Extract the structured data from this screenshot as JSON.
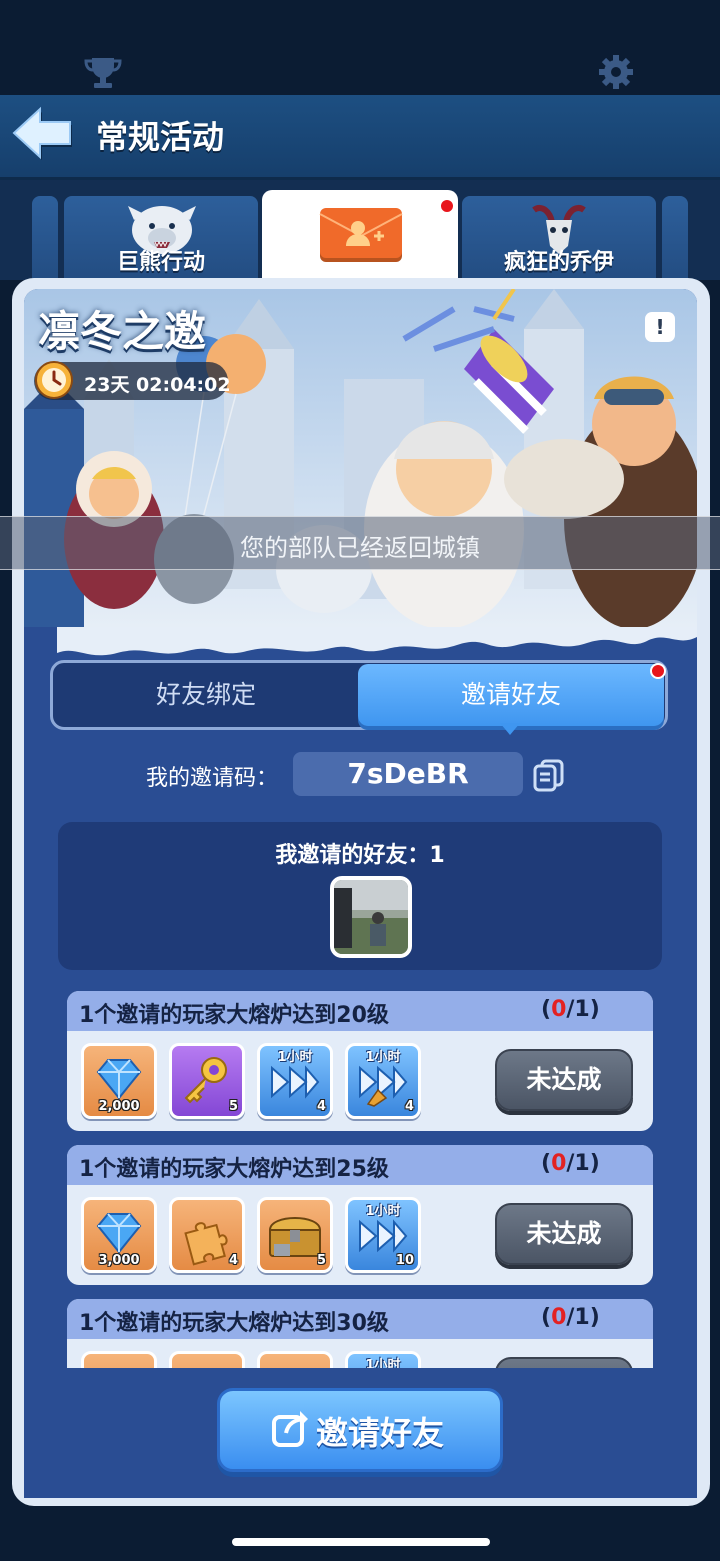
{
  "header": {
    "title": "常规活动",
    "trophy_icon": "trophy-icon",
    "settings_icon": "gear-icon",
    "back_icon": "back-arrow-icon"
  },
  "tabs": [
    {
      "label": "巨熊行动",
      "icon": "polar-bear-icon",
      "active": false
    },
    {
      "label": "",
      "icon": "invite-envelope-icon",
      "active": true,
      "badge": true
    },
    {
      "label": "疯狂的乔伊",
      "icon": "goat-skull-icon",
      "active": false
    }
  ],
  "event": {
    "title": "凛冬之邀",
    "timer": "23天 02:04:02",
    "info_label": "!"
  },
  "toast": "您的部队已经返回城镇",
  "segments": {
    "left": "好友绑定",
    "right": "邀请好友",
    "active": "right"
  },
  "invite_code": {
    "label": "我的邀请码：",
    "code": "7sDeBR",
    "copy_icon": "copy-icon"
  },
  "friends": {
    "label": "我邀请的好友：1"
  },
  "tasks": [
    {
      "title": "1个邀请的玩家大熔炉达到20级",
      "progress_current": "0",
      "progress_total": "/1)",
      "progress_open": "(",
      "button": "未达成",
      "rewards": [
        {
          "icon": "diamond-icon",
          "qty": "2,000",
          "color": "orange"
        },
        {
          "icon": "gold-key-icon",
          "qty": "5",
          "color": "purple"
        },
        {
          "icon": "speedup-icon",
          "qty": "4",
          "label": "1小时",
          "color": "blue"
        },
        {
          "icon": "build-speedup-icon",
          "qty": "4",
          "label": "1小时",
          "color": "blue"
        }
      ]
    },
    {
      "title": "1个邀请的玩家大熔炉达到25级",
      "progress_current": "0",
      "progress_total": "/1)",
      "progress_open": "(",
      "button": "未达成",
      "rewards": [
        {
          "icon": "diamond-icon",
          "qty": "3,000",
          "color": "orange"
        },
        {
          "icon": "puzzle-piece-icon",
          "qty": "4",
          "color": "orange"
        },
        {
          "icon": "treasure-chest-icon",
          "qty": "5",
          "color": "orange"
        },
        {
          "icon": "speedup-icon",
          "qty": "10",
          "label": "1小时",
          "color": "blue"
        }
      ]
    },
    {
      "title": "1个邀请的玩家大熔炉达到30级",
      "progress_current": "0",
      "progress_total": "/1)",
      "progress_open": "(",
      "button": "",
      "rewards": [
        {
          "icon": "item-icon",
          "qty": "",
          "color": "orange"
        },
        {
          "icon": "item-icon",
          "qty": "",
          "color": "orange"
        },
        {
          "icon": "item-icon",
          "qty": "",
          "color": "orange"
        },
        {
          "icon": "speedup-icon",
          "qty": "",
          "label": "1小时",
          "color": "blue"
        }
      ]
    }
  ],
  "invite_button": {
    "label": "邀请好友",
    "icon": "share-icon"
  },
  "colors": {
    "accent_blue": "#3f96f0",
    "panel_blue": "#2a4d93",
    "badge_red": "#e8161c",
    "progress_red": "#e32222"
  }
}
